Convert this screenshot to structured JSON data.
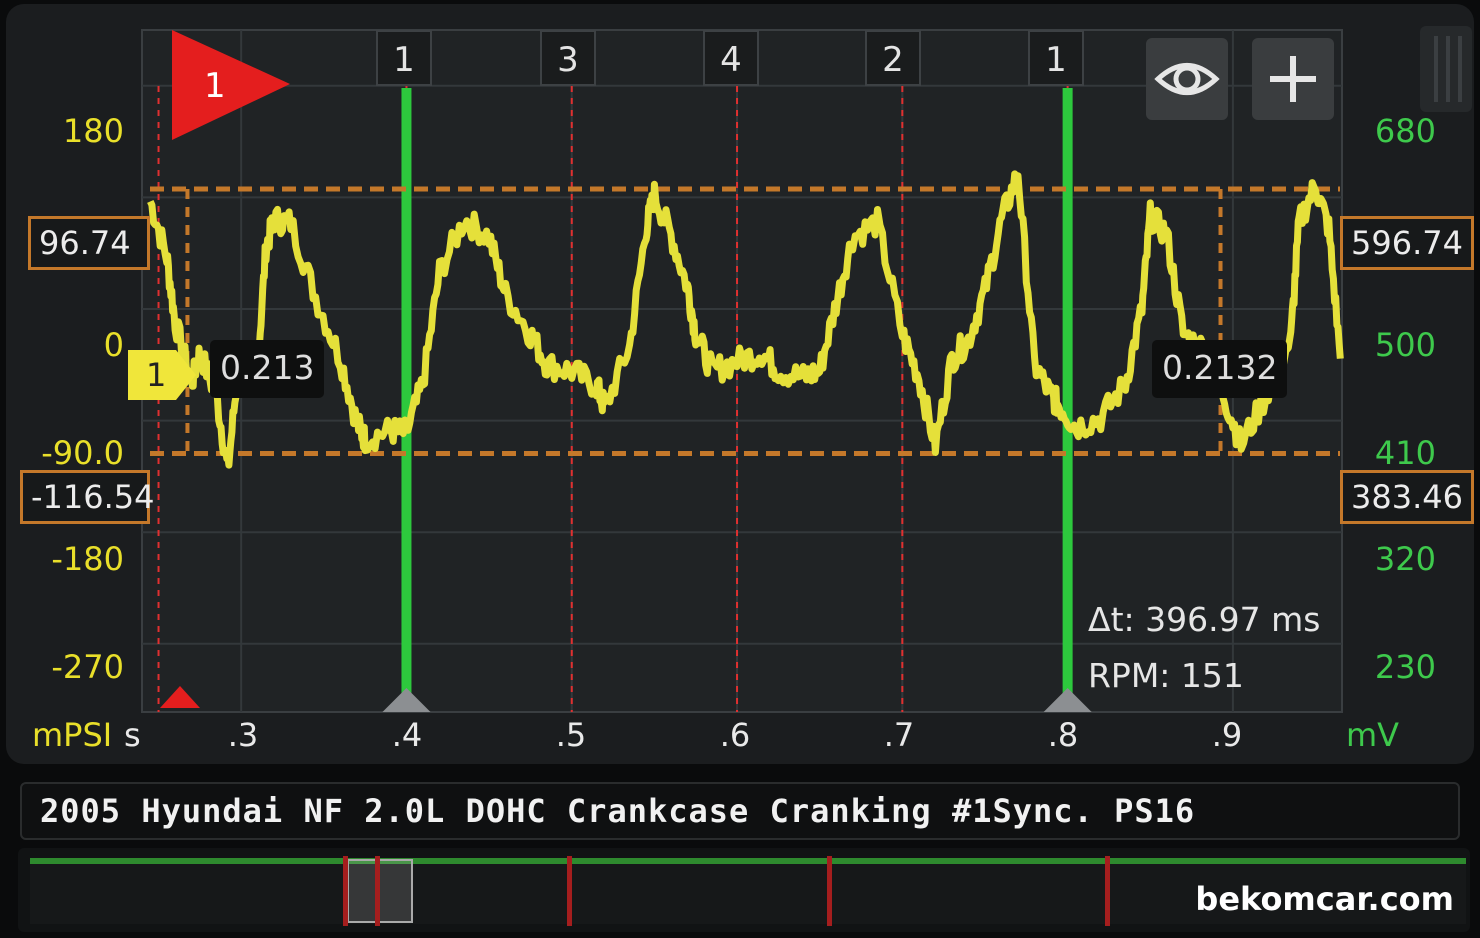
{
  "chart_data": {
    "type": "line",
    "title": "2005 Hyundai NF 2.0L DOHC Crankcase Cranking #1Sync. PS16",
    "x_unit": "s",
    "x_ticks": [
      ".3",
      ".4",
      ".5",
      ".6",
      ".7",
      ".8",
      ".9"
    ],
    "x_range": [
      0.24,
      0.966
    ],
    "left_axis": {
      "unit": "mPSI",
      "ticks": [
        "180",
        "0",
        "-90.0",
        "-180",
        "-270"
      ],
      "range": [
        -325,
        225
      ]
    },
    "right_axis": {
      "unit": "mV",
      "ticks": [
        "680",
        "500",
        "410",
        "320",
        "230"
      ],
      "range": [
        184,
        726
      ]
    },
    "series": [
      {
        "color": "#e5e03a",
        "x": [
          0.245,
          0.255,
          0.26,
          0.27,
          0.275,
          0.285,
          0.292,
          0.298,
          0.31,
          0.315,
          0.32,
          0.33,
          0.345,
          0.36,
          0.37,
          0.375,
          0.39,
          0.4,
          0.41,
          0.42,
          0.435,
          0.45,
          0.46,
          0.475,
          0.485,
          0.5,
          0.515,
          0.52,
          0.535,
          0.545,
          0.55,
          0.56,
          0.57,
          0.575,
          0.585,
          0.6,
          0.615,
          0.625,
          0.64,
          0.65,
          0.66,
          0.67,
          0.685,
          0.7,
          0.71,
          0.72,
          0.73,
          0.74,
          0.75,
          0.76,
          0.77,
          0.78,
          0.79,
          0.795,
          0.805,
          0.82,
          0.835,
          0.845,
          0.85,
          0.86,
          0.87,
          0.885,
          0.895,
          0.905,
          0.92,
          0.935,
          0.94,
          0.95,
          0.958,
          0.965
        ],
        "y": [
          87,
          42,
          -10,
          -60,
          -35,
          -70,
          -130,
          -50,
          -45,
          50,
          72,
          70,
          10,
          -40,
          -92,
          -105,
          -98,
          -100,
          -60,
          30,
          72,
          58,
          12,
          -20,
          -45,
          -50,
          -62,
          -80,
          -30,
          65,
          92,
          60,
          18,
          -20,
          -50,
          -42,
          -35,
          -50,
          -55,
          -50,
          5,
          58,
          70,
          -20,
          -55,
          -110,
          -40,
          -25,
          15,
          72,
          110,
          -45,
          -70,
          -78,
          -95,
          -88,
          -60,
          0,
          75,
          60,
          -20,
          -35,
          -72,
          -110,
          -70,
          -25,
          70,
          100,
          65,
          -40
        ]
      }
    ],
    "reference_levels": [
      {
        "left": "96.74",
        "right": "596.74",
        "value": 96.74
      },
      {
        "left": "-116.54",
        "right": "383.46",
        "value": -116.54
      }
    ],
    "trigger": {
      "label": "1",
      "x": 0.25,
      "channel_label": "1"
    },
    "cylinder_markers": [
      {
        "label": "1",
        "x": 0.4
      },
      {
        "label": "3",
        "x": 0.5
      },
      {
        "label": "4",
        "x": 0.6
      },
      {
        "label": "2",
        "x": 0.7
      },
      {
        "label": "1",
        "x": 0.8
      }
    ],
    "cursors": [
      {
        "x": 0.4
      },
      {
        "x": 0.8
      }
    ],
    "value_readouts": [
      "0.213",
      "0.2132"
    ],
    "measurements": {
      "delta_t": "Δt: 396.97 ms",
      "rpm": "RPM: 151"
    },
    "colors": {
      "trace": "#e5e03a",
      "reference": "#c4782a",
      "cursor": "#2dc93d",
      "marker_line": "#e03030"
    }
  },
  "title_bar": {
    "text": "2005 Hyundai NF 2.0L DOHC Crankcase Cranking #1Sync. PS16"
  },
  "watermark": "bekomcar.com",
  "toolbar": {
    "eye_icon": "eye-icon",
    "add_icon": "plus-icon"
  }
}
